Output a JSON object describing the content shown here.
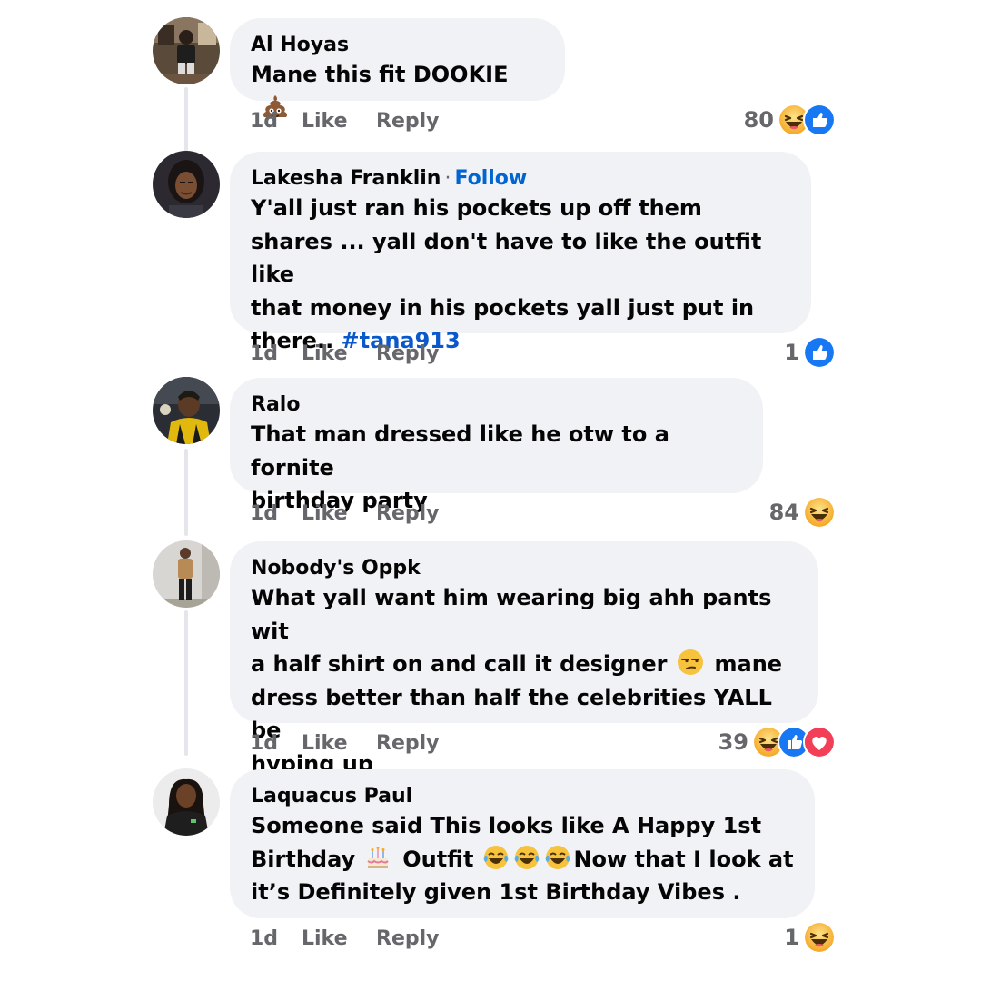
{
  "comments": [
    {
      "name": "Al Hoyas",
      "text_before_emoji": "Mane this fit DOOKIE",
      "emoji": "poop-emoji",
      "time": "1d",
      "like": "Like",
      "reply": "Reply",
      "reaction_count": "80",
      "reactions": [
        "haha-reaction",
        "like-reaction"
      ]
    },
    {
      "name": "Lakesha Franklin",
      "separator": "·",
      "follow": "Follow",
      "text_lines": [
        "Y'all just ran his pockets up off them",
        "shares ... yall don't have to like the outfit like",
        "that money in his pockets yall just put in"
      ],
      "text_last_prefix": "there.. ",
      "hashtag": "#tana913",
      "time": "1d",
      "like": "Like",
      "reply": "Reply",
      "reaction_count": "1",
      "reactions": [
        "like-reaction"
      ]
    },
    {
      "name": "Ralo",
      "text_lines": [
        "That man dressed like he otw to a fornite",
        "birthday party"
      ],
      "time": "1d",
      "like": "Like",
      "reply": "Reply",
      "reaction_count": "84",
      "reactions": [
        "haha-reaction"
      ]
    },
    {
      "name": "Nobody's Oppk",
      "text_line1": "What yall want him wearing big ahh pants wit",
      "text_line2_before": "a half shirt on and call it designer",
      "emoji": "unamused-emoji",
      "text_line2_after": "mane",
      "text_line3": "dress better than half the celebrities YALL be",
      "text_line4": "hyping up",
      "time": "1d",
      "like": "Like",
      "reply": "Reply",
      "reaction_count": "39",
      "reactions": [
        "haha-reaction",
        "like-reaction",
        "love-reaction"
      ]
    },
    {
      "name": "Laquacus Paul",
      "text_line1": "Someone said This looks like A Happy 1st",
      "text_line2_a": "Birthday",
      "emoji_cake": "birthday-cake-emoji",
      "text_line2_b": "Outfit",
      "emoji_laugh": "tears-of-joy-emoji",
      "text_line2_c": "Now that I look at",
      "text_line3": "it’s Definitely given 1st Birthday Vibes .",
      "time": "1d",
      "like": "Like",
      "reply": "Reply",
      "reaction_count": "1",
      "reactions": [
        "haha-reaction"
      ]
    }
  ],
  "colors": {
    "bubble": "#f0f2f5",
    "meta_text": "#65676b",
    "link_blue": "#0064d1",
    "like_blue": "#1877f2",
    "love_red": "#f33e58",
    "haha_yellow": "#f7b125"
  }
}
